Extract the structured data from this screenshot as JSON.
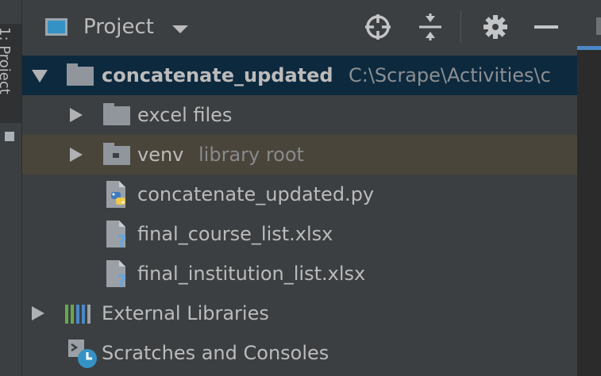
{
  "side_tab": {
    "label": "1: Project"
  },
  "header": {
    "title": "Project",
    "buttons": [
      "locate-icon",
      "collapse-all-icon",
      "gear-icon",
      "minimize-icon"
    ]
  },
  "tree": {
    "root": {
      "name": "concatenate_updated",
      "path": "C:\\Scrape\\Activities\\c"
    },
    "items": [
      {
        "name": "excel files",
        "icon": "folder-icon"
      },
      {
        "name": "venv",
        "hint": "library root",
        "icon": "library-folder-icon"
      },
      {
        "name": "concatenate_updated.py",
        "icon": "python-file-icon"
      },
      {
        "name": "final_course_list.xlsx",
        "icon": "unknown-file-icon"
      },
      {
        "name": "final_institution_list.xlsx",
        "icon": "unknown-file-icon"
      }
    ],
    "external_libraries": "External Libraries",
    "scratches": "Scratches and Consoles"
  },
  "colors": {
    "background": "#3c3f41",
    "selected_row": "#0d293e",
    "highlighted_row": "#4a453a",
    "accent": "#4a88c7",
    "text": "#bbbbbb"
  }
}
